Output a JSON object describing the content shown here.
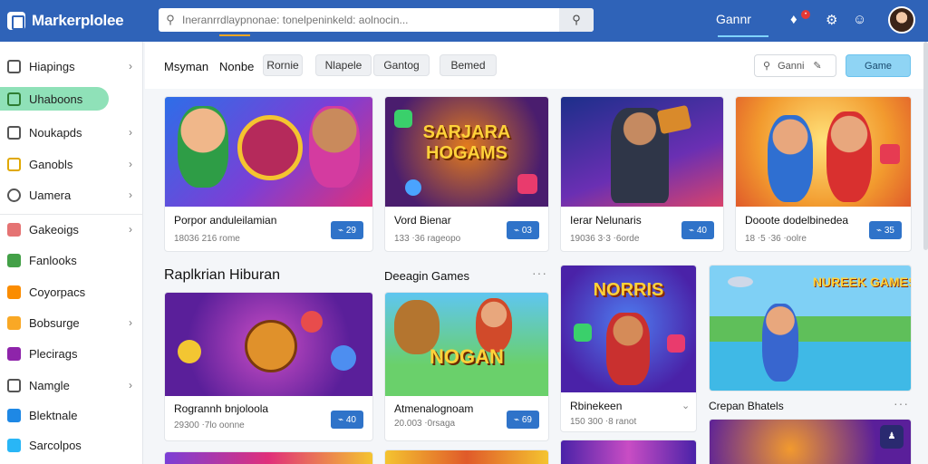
{
  "app": {
    "title": "Markerplolee",
    "active_tab": "Gannr"
  },
  "search": {
    "placeholder": "Ineranrrdlaypnonae: tonelpeninkeld: aolnocin..."
  },
  "sidebar": {
    "items": [
      {
        "label": "Hiapings",
        "icon": "grid-icon",
        "color": "#555",
        "chevron": true
      },
      {
        "label": "Uhaboons",
        "icon": "home-icon",
        "color": "#2e7d32",
        "active": true
      },
      {
        "label": "Noukapds",
        "icon": "calendar-icon",
        "color": "#555",
        "chevron": true
      },
      {
        "label": "Ganobls",
        "icon": "gamepad-icon",
        "color": "#e0a800",
        "chevron": true
      },
      {
        "label": "Uamera",
        "icon": "circle-icon",
        "color": "#555",
        "chevron": true
      },
      {
        "label": "Gakeoigs",
        "icon": "stack-icon",
        "color": "#e57373",
        "chevron": true
      },
      {
        "label": "Fanlooks",
        "icon": "puzzle-icon",
        "color": "#43a047"
      },
      {
        "label": "Coyorpacs",
        "icon": "star-icon",
        "color": "#fb8c00"
      },
      {
        "label": "Bobsurge",
        "icon": "shop-icon",
        "color": "#f9a825",
        "chevron": true
      },
      {
        "label": "Plecirags",
        "icon": "tag-icon",
        "color": "#8e24aa"
      },
      {
        "label": "Namgle",
        "icon": "doc-icon",
        "color": "#555",
        "chevron": true
      },
      {
        "label": "Blektnale",
        "icon": "book-icon",
        "color": "#1e88e5"
      },
      {
        "label": "Sarcolpos",
        "icon": "chat-icon",
        "color": "#29b6f6"
      }
    ]
  },
  "filters": {
    "tab1": "Msyman",
    "tab2": "Nonbe",
    "chips": [
      "Rornie",
      "Nlapele",
      "Gantog",
      "Bemed"
    ],
    "search_label": "Ganni",
    "game_button": "Game"
  },
  "top_cards": [
    {
      "title": "Porpor anduleilamian",
      "meta": "18036 216 rome",
      "btn": "⌁ 29"
    },
    {
      "title": "Vord Bienar",
      "meta": "133 ⋅36 rageopo",
      "btn": "⌁ 03"
    },
    {
      "title": "Ierar Nelunaris",
      "meta": "19036 3⋅3 ⋅6orde",
      "btn": "⌁ 40"
    },
    {
      "title": "Dooote dodelbinedea",
      "meta": "18 ⋅5 ⋅36 ⋅oolre",
      "btn": "⌁ 35"
    }
  ],
  "sections": {
    "left": "Raplkrian Hiburan",
    "middle": "Deeagin Games",
    "right": "Crepan Bhatels"
  },
  "mid_cards": [
    {
      "title": "Rogrannh bnjoloola",
      "meta": "29300 ⋅7lo oonne",
      "btn": "⌁ 40"
    },
    {
      "title": "Atmenalognoam",
      "meta": "20.003 ⋅0rsaga",
      "btn": "⌁ 69"
    },
    {
      "title": "Rbinekeen",
      "meta": "150 300 ⋅8 ranot"
    }
  ],
  "thumb_text": {
    "t2": "SARJARA HOGAMS",
    "t3": "NORRIS",
    "t5": "NOGAN",
    "t6": "NUREEK GAMES"
  },
  "colors": {
    "brand": "#2f63b8",
    "accent": "#f5a623",
    "active_sidebar": "#8fe1b8",
    "button": "#2f73c9"
  }
}
